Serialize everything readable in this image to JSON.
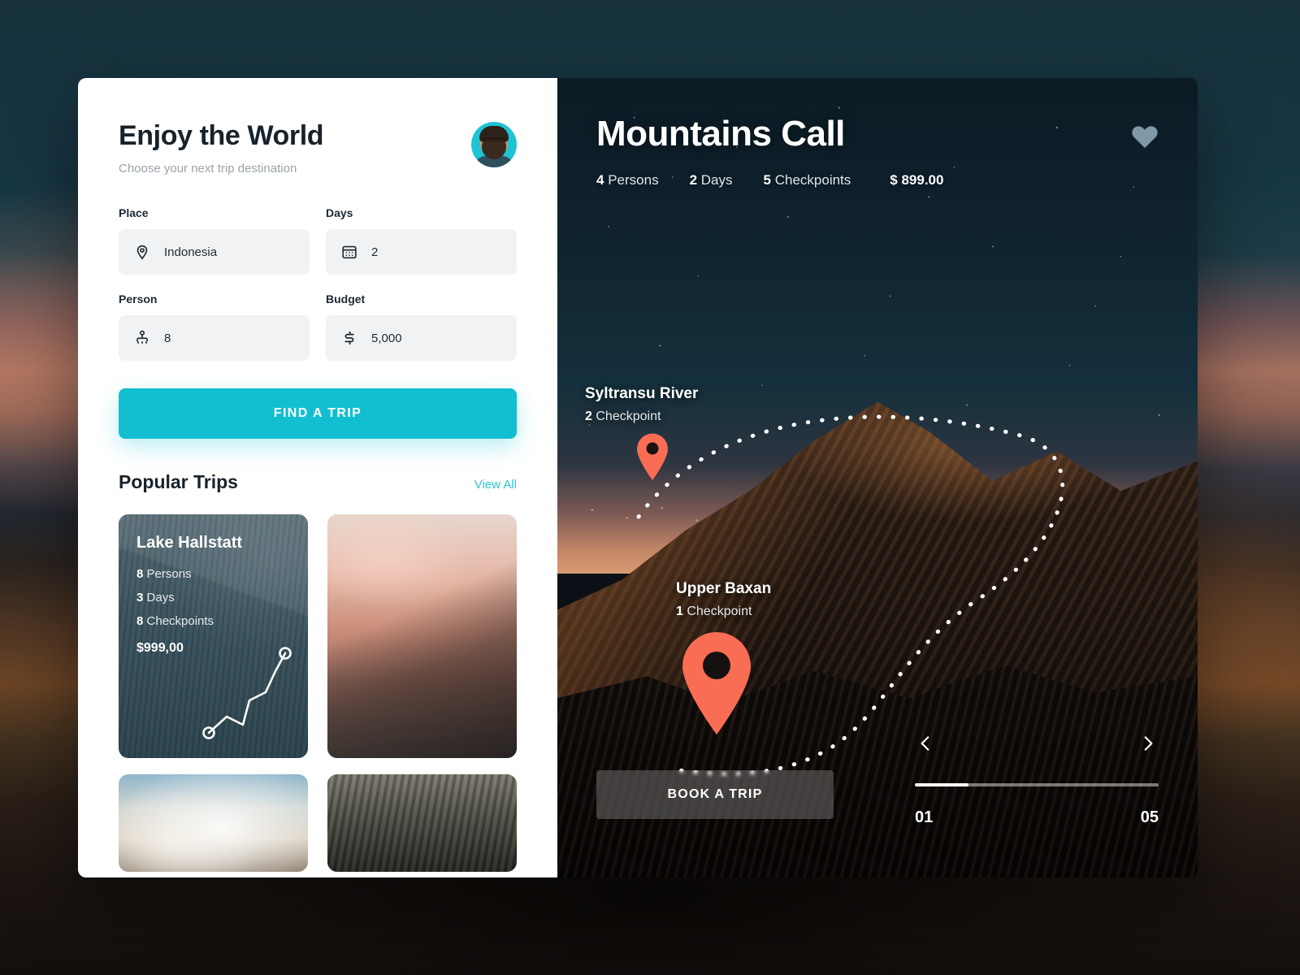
{
  "left": {
    "title": "Enjoy the World",
    "subtitle": "Choose your next trip destination",
    "avatar_name": "user-avatar",
    "form": {
      "place": {
        "label": "Place",
        "value": "Indonesia",
        "icon": "location-pin-icon"
      },
      "days": {
        "label": "Days",
        "value": "2",
        "icon": "calendar-icon"
      },
      "person": {
        "label": "Person",
        "value": "8",
        "icon": "person-icon"
      },
      "budget": {
        "label": "Budget",
        "value": "5,000",
        "icon": "currency-icon"
      }
    },
    "find_button": "FIND A TRIP",
    "popular": {
      "heading": "Popular Trips",
      "view_all": "View All"
    },
    "trips": [
      {
        "name": "Lake Hallstatt",
        "persons_num": "8",
        "persons_word": "Persons",
        "days_num": "3",
        "days_word": "Days",
        "checkpoints_num": "8",
        "checkpoints_word": "Checkpoints",
        "price": "$999,00"
      },
      {
        "name": ""
      },
      {
        "name": ""
      },
      {
        "name": ""
      }
    ]
  },
  "right": {
    "title": "Mountains Call",
    "favorite_icon": "heart-icon",
    "meta": {
      "persons_num": "4",
      "persons_word": "Persons",
      "days_num": "2",
      "days_word": "Days",
      "checkpoints_num": "5",
      "checkpoints_word": "Checkpoints",
      "price": "$ 899.00"
    },
    "markers": [
      {
        "name": "Syltransu River",
        "count": "2",
        "unit": "Checkpoint"
      },
      {
        "name": "Upper Baxan",
        "count": "1",
        "unit": "Checkpoint"
      }
    ],
    "book_button": "BOOK A TRIP",
    "pager": {
      "current": "01",
      "total": "05"
    },
    "prev_icon": "chevron-left-icon",
    "next_icon": "chevron-right-icon"
  },
  "colors": {
    "accent_cyan": "#12bfd1",
    "link_cyan": "#2dc5d3",
    "marker_coral": "#f96d54",
    "heart_blue": "#7f99a8",
    "dark_bg": "#13272f"
  }
}
